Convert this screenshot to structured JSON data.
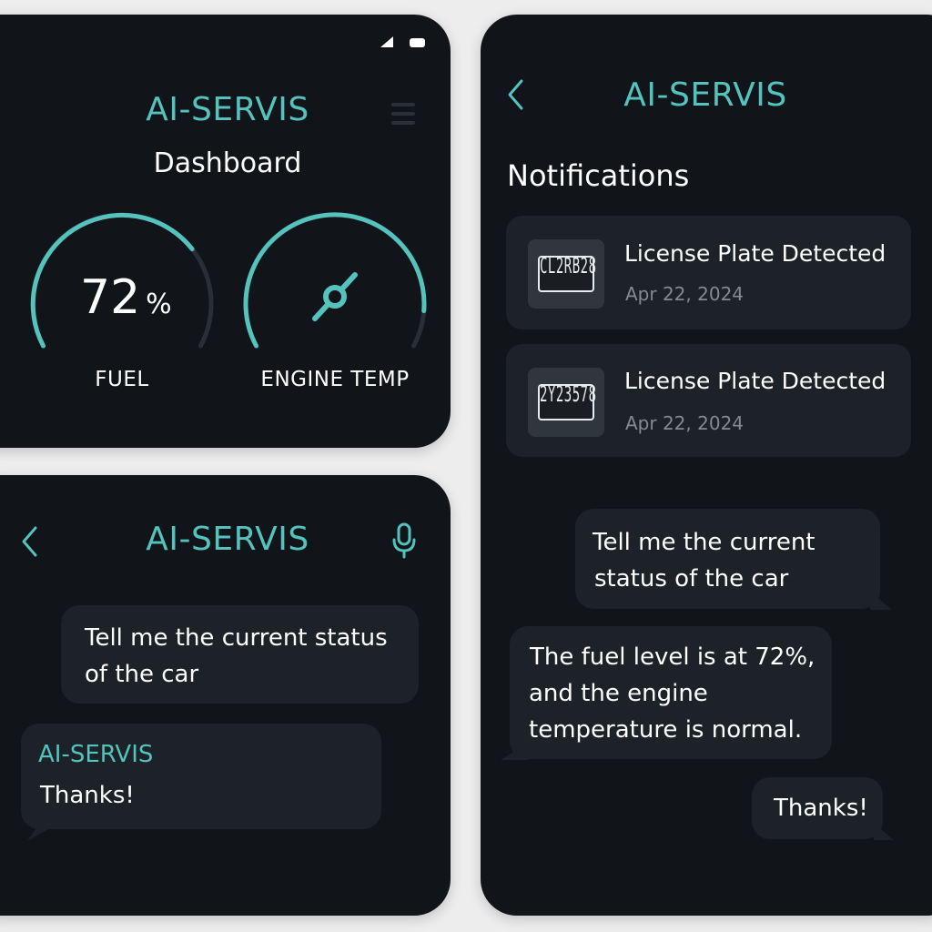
{
  "app_name": "AI-SERVIS",
  "dashboard": {
    "subtitle": "Dashboard",
    "fuel": {
      "value": "72",
      "unit": "%",
      "label": "FUEL",
      "level": 0.72
    },
    "engine_temp": {
      "label": "ENGINE TEMP",
      "level": 0.9
    },
    "status_icons": [
      "signal-icon",
      "battery-icon"
    ],
    "menu_icon": "menu-icon"
  },
  "chat_panel": {
    "back_icon": "chevron-left-icon",
    "mic_icon": "microphone-icon",
    "messages": [
      {
        "from": "user",
        "lines": [
          "Tell me the current status",
          "of the car"
        ]
      },
      {
        "from": "assistant",
        "sender": "AI-SERVIS",
        "lines": [
          "Thanks!"
        ]
      }
    ]
  },
  "notifications_panel": {
    "back_icon": "chevron-left-icon",
    "heading": "Notifications",
    "items": [
      {
        "plate": "CL2RB28",
        "title": "License Plate Detected",
        "date": "Apr 22, 2024"
      },
      {
        "plate": "2Y23578",
        "title": "License Plate Detected",
        "date": "Apr 22, 2024"
      }
    ],
    "messages": [
      {
        "from": "user",
        "lines": [
          "Tell me the current",
          "status of the car"
        ]
      },
      {
        "from": "assistant",
        "lines": [
          "The fuel level is at 72%,",
          "and the engine",
          "temperature is normal."
        ]
      },
      {
        "from": "user",
        "lines": [
          "Thanks!"
        ]
      }
    ]
  },
  "colors": {
    "accent": "#54c2bd",
    "panel_bg": "#111418",
    "card_bg": "#1d2228",
    "page_bg": "#ededee",
    "muted_text": "#848a91"
  }
}
